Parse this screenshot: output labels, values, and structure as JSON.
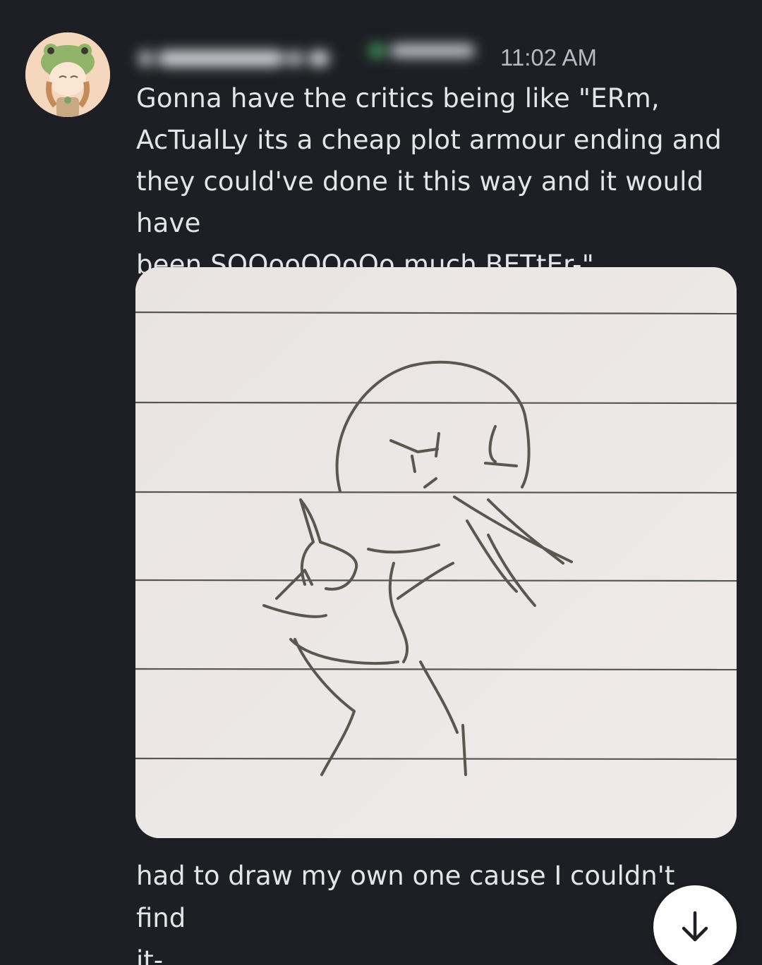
{
  "message": {
    "author_display": "",
    "timestamp": "11:02 AM",
    "text": "Gonna have the critics being like \"ERm,\nAcTualLy its a cheap plot armour ending and\nthey could've done it this way and it would have\nbeen SOOooOOoOo much BETtEr-\"",
    "caption": "had to draw my own one cause I couldn't find\nit-"
  },
  "avatar": {
    "icon": "frog-hat-avatar-icon"
  },
  "scroll_button": {
    "icon": "arrow-down-icon"
  },
  "colors": {
    "background": "#1e1f24",
    "text": "#e3e5e8",
    "timestamp": "#b6bac2",
    "online_status": "#47b36a"
  }
}
